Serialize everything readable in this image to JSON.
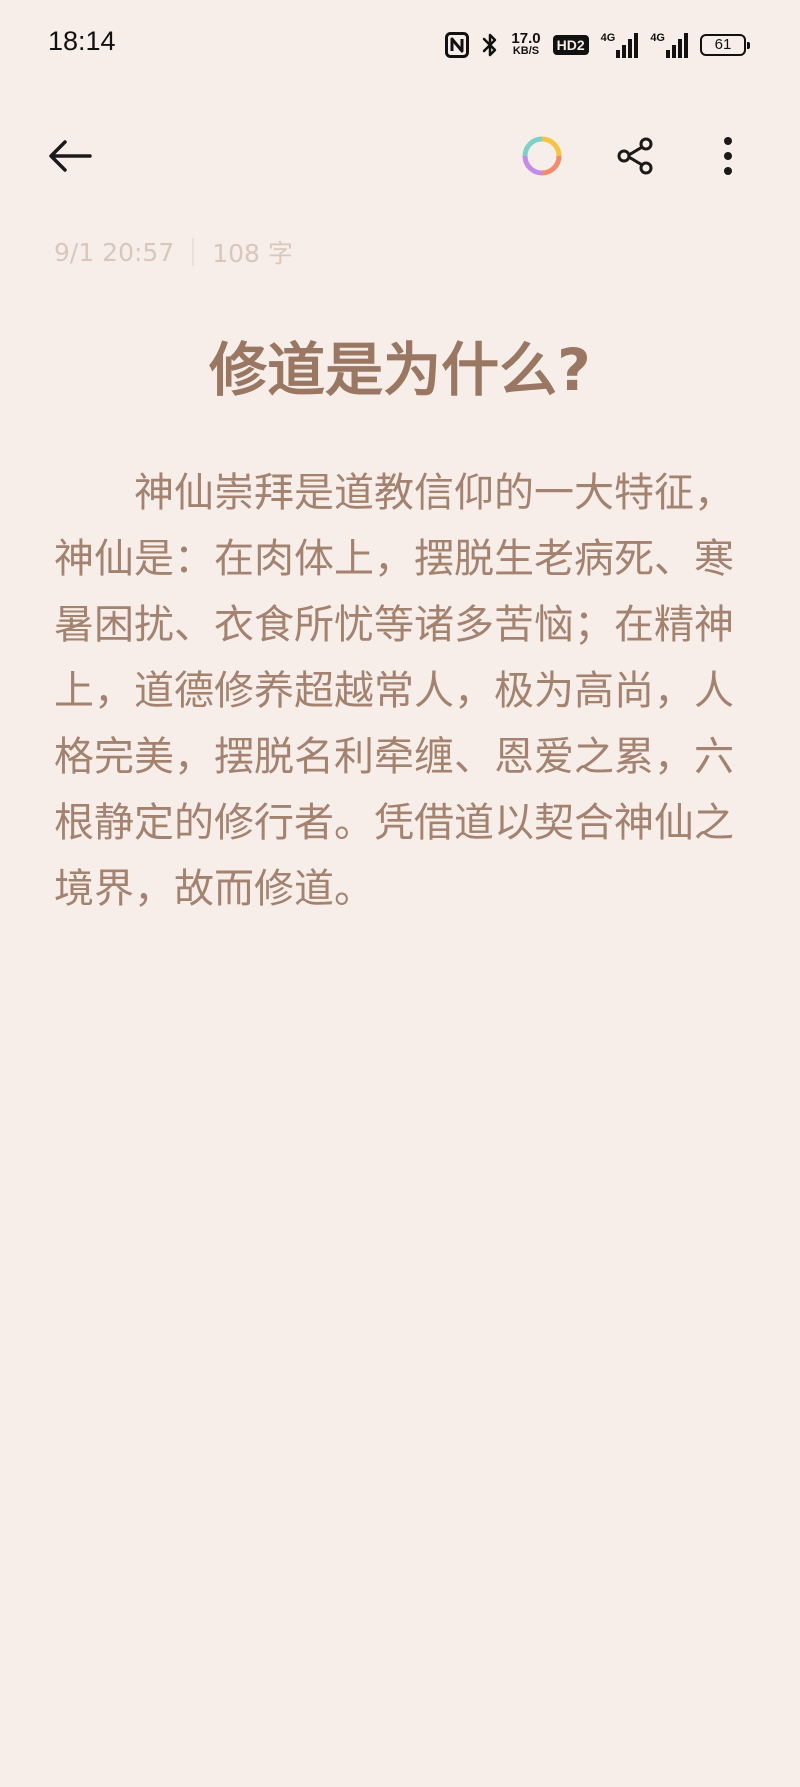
{
  "status_bar": {
    "time": "18:14",
    "net_speed_value": "17.0",
    "net_speed_unit": "KB/S",
    "hd_badge": "HD2",
    "sim1_label": "4G",
    "sim2_label": "4G",
    "battery_level": "61",
    "icons": [
      "nfc-icon",
      "bluetooth-icon",
      "signal-icon",
      "signal-icon",
      "battery-icon"
    ]
  },
  "toolbar": {
    "back_icon": "arrow-left-icon",
    "palette_icon": "color-ring-icon",
    "share_icon": "share-icon",
    "more_icon": "more-vertical-icon"
  },
  "meta": {
    "date": "9/1 20:57",
    "word_count": "108 字"
  },
  "note": {
    "title": "修道是为什么?",
    "body": "神仙崇拜是道教信仰的一大特征，神仙是：在肉体上，摆脱生老病死、寒暑困扰、衣食所忧等诸多苦恼；在精神上，道德修养超越常人，极为高尚，人格完美，摆脱名利牵缠、恩爱之累，六根静定的修行者。凭借道以契合神仙之境界，故而修道。"
  },
  "colors": {
    "background": "#f8eee9",
    "text": "#a3826f",
    "title": "#9a7763",
    "meta": "#d8c7bd"
  }
}
